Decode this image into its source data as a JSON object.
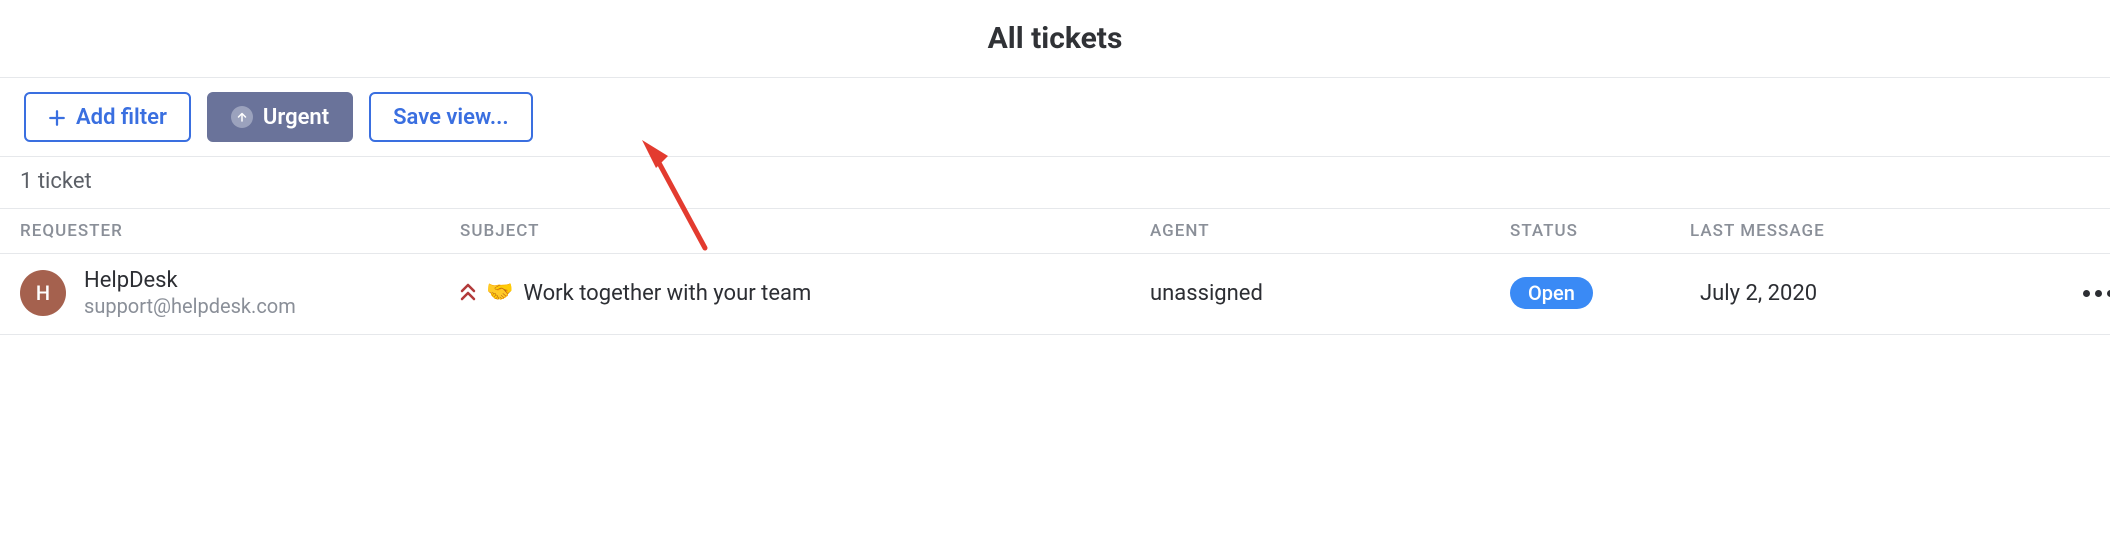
{
  "header": {
    "title": "All tickets"
  },
  "toolbar": {
    "add_filter_label": "Add filter",
    "urgent_chip_label": "Urgent",
    "save_view_label": "Save view...",
    "colors": {
      "primary": "#3a6fe0",
      "chip_bg": "#6a739a"
    }
  },
  "summary": {
    "count_text": "1 ticket"
  },
  "columns": {
    "requester": "REQUESTER",
    "subject": "SUBJECT",
    "agent": "AGENT",
    "status": "STATUS",
    "last_message": "LAST MESSAGE"
  },
  "rows": [
    {
      "avatar_letter": "H",
      "requester_name": "HelpDesk",
      "requester_email": "support@helpdesk.com",
      "subject_text": "Work together with your team",
      "subject_icons": {
        "priority": "urgent",
        "handshake": true
      },
      "agent": "unassigned",
      "status_label": "Open",
      "status_kind": "open",
      "last_message": "July 2, 2020"
    }
  ]
}
